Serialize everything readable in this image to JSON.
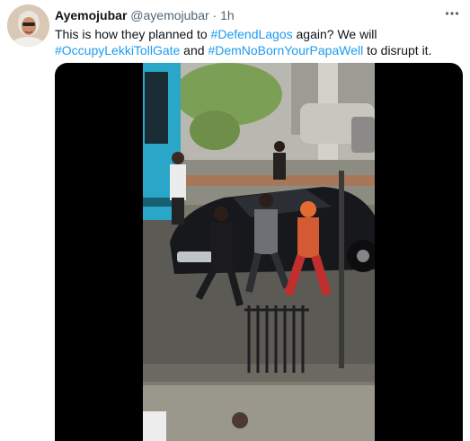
{
  "tweet": {
    "display_name": "Ayemojubar",
    "handle": "@ayemojubar",
    "separator": "·",
    "timestamp": "1h",
    "text_parts": {
      "p1": "This is how they planned to ",
      "hashtag1": "#DefendLagos",
      "p2": " again? We will",
      "hashtag2": "#OccupyLekkiTollGate",
      "p3": " and ",
      "hashtag3": "#DemNoBornYourPapaWell",
      "p4": " to disrupt it."
    },
    "more_icon": "more-horizontal-icon",
    "media": {
      "type": "video",
      "playback_icon": "none"
    }
  },
  "colors": {
    "text": "#0f1419",
    "secondary": "#536471",
    "link": "#1d9bf0",
    "media_bg": "#000000"
  }
}
